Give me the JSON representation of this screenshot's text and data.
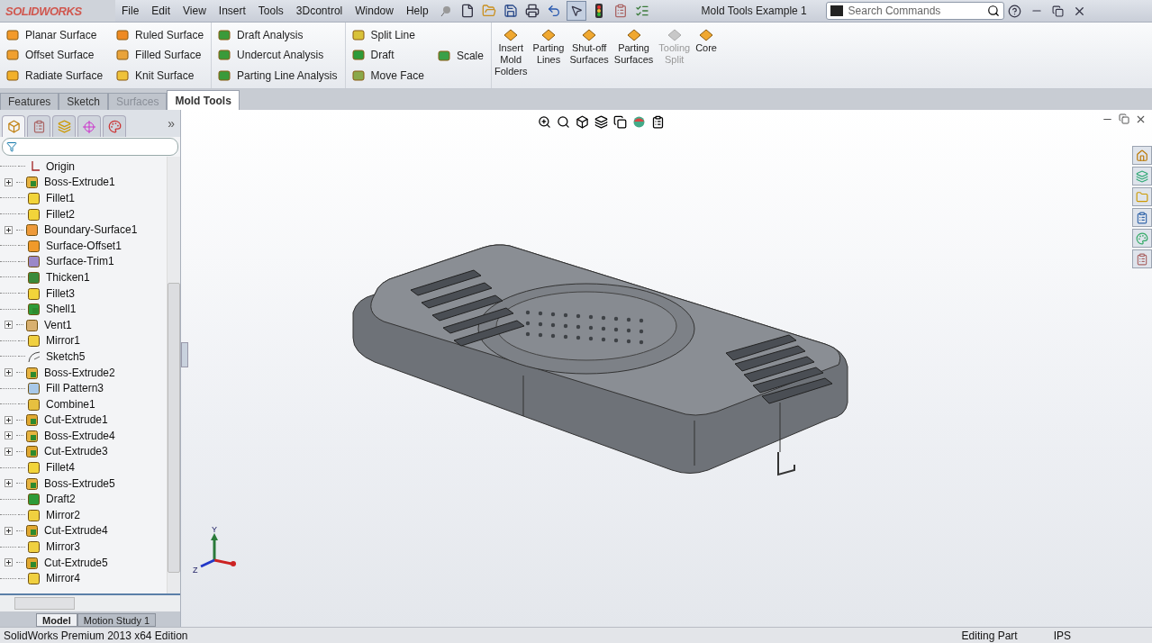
{
  "app": {
    "logo": "SOLIDWORKS"
  },
  "menu": [
    "File",
    "Edit",
    "View",
    "Insert",
    "Tools",
    "3Dcontrol",
    "Window",
    "Help"
  ],
  "window": {
    "title": "Mold Tools Example 1"
  },
  "search": {
    "placeholder": "Search Commands"
  },
  "ribbon": {
    "columns": [
      [
        {
          "label": "Planar Surface",
          "kind": "planar"
        },
        {
          "label": "Offset Surface",
          "kind": "offset"
        },
        {
          "label": "Radiate Surface",
          "kind": "radiate"
        }
      ],
      [
        {
          "label": "Ruled Surface",
          "kind": "ruled"
        },
        {
          "label": "Filled Surface",
          "kind": "filled"
        },
        {
          "label": "Knit Surface",
          "kind": "knit"
        }
      ],
      [
        {
          "label": "Draft Analysis",
          "kind": "analysis"
        },
        {
          "label": "Undercut Analysis",
          "kind": "analysis"
        },
        {
          "label": "Parting Line Analysis",
          "kind": "analysis"
        }
      ],
      [
        {
          "label": "Split Line",
          "kind": "split"
        },
        {
          "label": "Draft",
          "kind": "draft"
        },
        {
          "label": "Move Face",
          "kind": "move"
        }
      ],
      [
        {
          "label": "Scale",
          "kind": "scale"
        }
      ]
    ],
    "large_buttons": [
      {
        "label": "Insert Mold Folders",
        "disabled": false
      },
      {
        "label": "Parting Lines",
        "disabled": false
      },
      {
        "label": "Shut-off Surfaces",
        "disabled": false
      },
      {
        "label": "Parting Surfaces",
        "disabled": false
      },
      {
        "label": "Tooling Split",
        "disabled": true
      },
      {
        "label": "Core",
        "disabled": false
      }
    ]
  },
  "panel": {
    "more": "»"
  },
  "tabs": [
    {
      "label": "Features",
      "selected": false,
      "disabled": false
    },
    {
      "label": "Sketch",
      "selected": false,
      "disabled": false
    },
    {
      "label": "Surfaces",
      "selected": false,
      "disabled": true
    },
    {
      "label": "Mold Tools",
      "selected": true,
      "disabled": false
    }
  ],
  "tree": [
    {
      "name": "Origin",
      "kind": "origin",
      "expandable": false
    },
    {
      "name": "Boss-Extrude1",
      "kind": "boss",
      "expandable": true
    },
    {
      "name": "Fillet1",
      "kind": "fillet",
      "expandable": false
    },
    {
      "name": "Fillet2",
      "kind": "fillet",
      "expandable": false
    },
    {
      "name": "Boundary-Surface1",
      "kind": "surface",
      "expandable": true
    },
    {
      "name": "Surface-Offset1",
      "kind": "offset",
      "expandable": false
    },
    {
      "name": "Surface-Trim1",
      "kind": "trim",
      "expandable": false
    },
    {
      "name": "Thicken1",
      "kind": "thicken",
      "expandable": false
    },
    {
      "name": "Fillet3",
      "kind": "fillet",
      "expandable": false
    },
    {
      "name": "Shell1",
      "kind": "shell",
      "expandable": false
    },
    {
      "name": "Vent1",
      "kind": "vent",
      "expandable": true
    },
    {
      "name": "Mirror1",
      "kind": "mirror",
      "expandable": false
    },
    {
      "name": "Sketch5",
      "kind": "sketch",
      "expandable": false
    },
    {
      "name": "Boss-Extrude2",
      "kind": "boss",
      "expandable": true
    },
    {
      "name": "Fill Pattern3",
      "kind": "pattern",
      "expandable": false
    },
    {
      "name": "Combine1",
      "kind": "combine",
      "expandable": false
    },
    {
      "name": "Cut-Extrude1",
      "kind": "cut",
      "expandable": true
    },
    {
      "name": "Boss-Extrude4",
      "kind": "boss",
      "expandable": true
    },
    {
      "name": "Cut-Extrude3",
      "kind": "cut",
      "expandable": true
    },
    {
      "name": "Fillet4",
      "kind": "fillet",
      "expandable": false
    },
    {
      "name": "Boss-Extrude5",
      "kind": "boss",
      "expandable": true
    },
    {
      "name": "Draft2",
      "kind": "draft",
      "expandable": false
    },
    {
      "name": "Mirror2",
      "kind": "mirror",
      "expandable": false
    },
    {
      "name": "Cut-Extrude4",
      "kind": "cut",
      "expandable": true
    },
    {
      "name": "Mirror3",
      "kind": "mirror",
      "expandable": false
    },
    {
      "name": "Cut-Extrude5",
      "kind": "cut",
      "expandable": true
    },
    {
      "name": "Mirror4",
      "kind": "mirror",
      "expandable": false
    }
  ],
  "bottom_tabs": [
    {
      "label": "Model",
      "selected": true
    },
    {
      "label": "Motion Study 1",
      "selected": false
    }
  ],
  "triad": {
    "y": "Y",
    "z": "Z"
  },
  "status_bar": {
    "product": "SolidWorks Premium 2013 x64 Edition",
    "mode": "Editing Part",
    "units": "IPS"
  }
}
